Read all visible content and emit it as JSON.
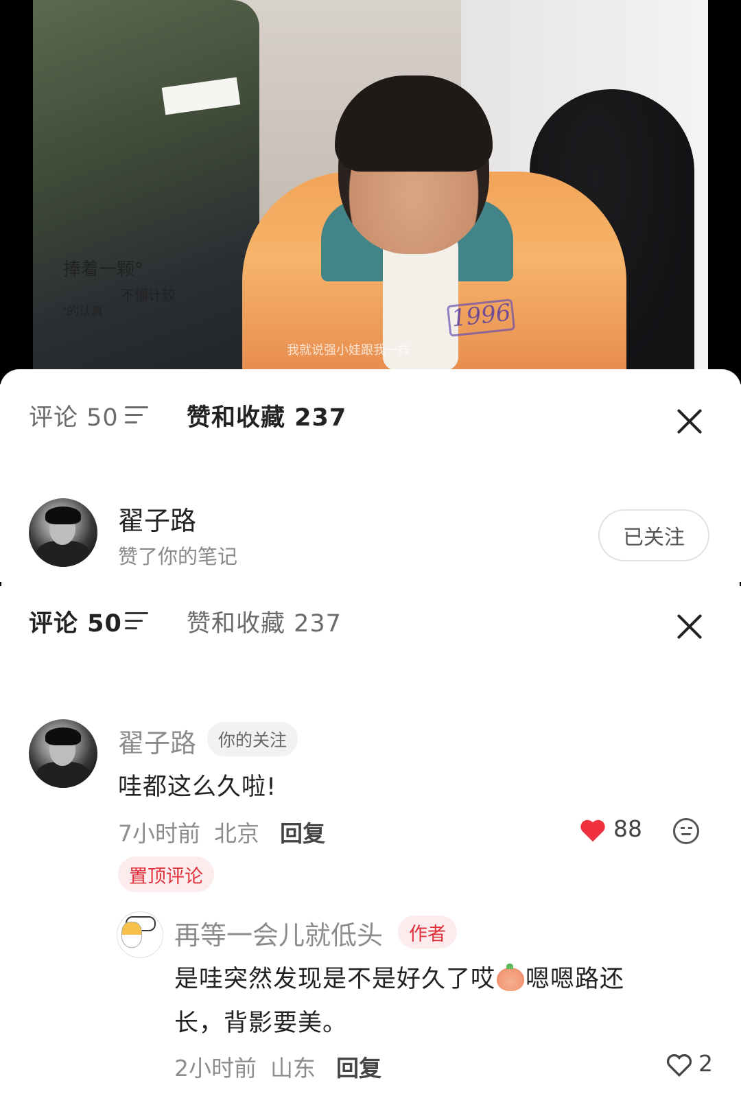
{
  "photo": {
    "caption_line1": "捧着一颗°",
    "caption_line2": "不懂计较",
    "caption_line3": "'的认真",
    "jacket_text": "1996",
    "subtitle": "我就说强小娃跟我一样"
  },
  "panel1": {
    "tabs": {
      "comments": "评论 50",
      "likes": "赞和收藏 237"
    },
    "user": {
      "name": "翟子路",
      "action": "赞了你的笔记",
      "follow_label": "已关注"
    }
  },
  "panel2": {
    "tabs": {
      "comments": "评论 50",
      "likes": "赞和收藏 237"
    },
    "comment": {
      "user": "翟子路",
      "badge": "你的关注",
      "text": "哇都这么久啦!",
      "time": "7小时前",
      "location": "北京",
      "reply_label": "回复",
      "likes": "88",
      "pinned_label": "置顶评论"
    },
    "reply": {
      "user": "再等一会儿就低头",
      "badge": "作者",
      "text_part1": "是哇突然发现是不是好久了哎",
      "text_part2": "嗯嗯路还",
      "text_line2": "长，背影要美。",
      "time": "2小时前",
      "location": "山东",
      "reply_label": "回复",
      "likes": "2"
    }
  },
  "colors": {
    "accent": "#e0323c",
    "heart": "#f0303e",
    "muted": "#8c8c8c"
  }
}
